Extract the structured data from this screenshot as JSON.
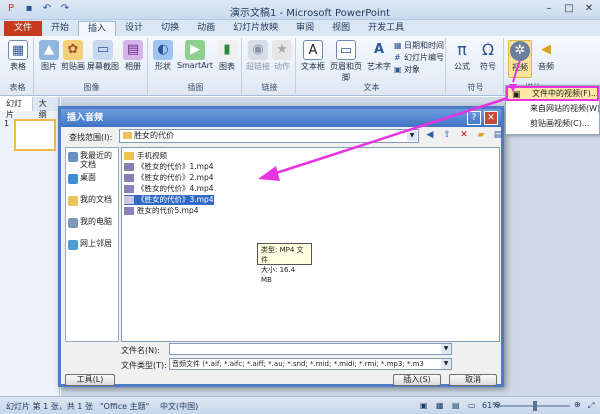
{
  "window": {
    "title": "演示文稿1 - Microsoft PowerPoint"
  },
  "tabs": [
    "文件",
    "开始",
    "插入",
    "设计",
    "切换",
    "动画",
    "幻灯片放映",
    "审阅",
    "视图",
    "开发工具"
  ],
  "ribbon": {
    "groups": {
      "table": "表格",
      "images": "图像",
      "illustrations": "插图",
      "links": "链接",
      "text": "文本",
      "symbols": "符号",
      "media": "媒体"
    },
    "buttons": {
      "table": "表格",
      "picture": "图片",
      "clipart": "剪贴画",
      "screenshot": "屏幕截图",
      "album": "相册",
      "shapes": "形状",
      "smartart": "SmartArt",
      "chart": "图表",
      "hyperlink": "超链接",
      "action": "动作",
      "textbox": "文本框",
      "headerfooter": "页眉和页脚",
      "wordart": "艺术字",
      "datetime": "日期和时间",
      "slidenumber": "幻灯片编号",
      "object": "对象",
      "equation": "公式",
      "symbol": "符号",
      "video": "视频",
      "audio": "音频"
    }
  },
  "video_menu": {
    "items": [
      "文件中的视频(F)...",
      "来自网站的视频(W)...",
      "剪贴画视频(C)..."
    ]
  },
  "left_pane": {
    "tabs": [
      "幻灯片",
      "大纲"
    ],
    "slide_number": "1"
  },
  "dialog": {
    "title": "插入音频",
    "help": "?",
    "close": "✕",
    "look_in_label": "查找范围(I):",
    "look_in_value": "胜女的代价",
    "places": [
      "我最近的文档",
      "桌面",
      "我的文档",
      "我的电脑",
      "网上邻居"
    ],
    "files": [
      "手机视频",
      "《胜女的代价》1.mp4",
      "《胜女的代价》2.mp4",
      "《胜女的代价》4.mp4",
      "《胜女的代价》3.mp4",
      "胜女的代价5.mp4"
    ],
    "selected_file": "《胜女的代价》3.mp4",
    "tooltip": {
      "type": "类型: MP4 文件",
      "size": "大小: 16.4 MB"
    },
    "file_name_label": "文件名(N):",
    "file_name_value": "",
    "file_type_label": "文件类型(T):",
    "file_type_value": "音频文件 (*.aif; *.aifc; *.aiff; *.au; *.snd; *.mid; *.midi; *.rmi; *.mp3; *.m3",
    "tools_button": "工具(L)",
    "insert_button": "插入(S)",
    "cancel_button": "取消"
  },
  "status": {
    "slide": "幻灯片 第 1 张，共 1 张",
    "theme": "\"Office 主题\"",
    "language": "中文(中国)",
    "zoom": "61%"
  },
  "colors": {
    "accent": "#e834e0",
    "file_tab": "#c63a1f",
    "selection": "#316ac5"
  }
}
